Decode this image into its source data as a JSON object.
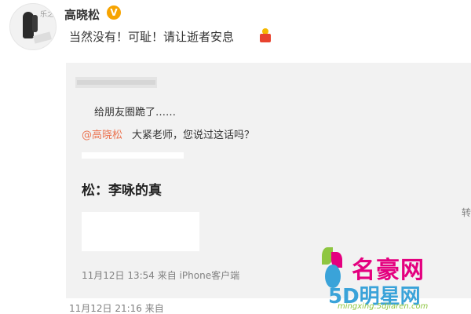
{
  "post": {
    "username": "高晓松",
    "badge": "V",
    "text": "当然没有！可耻！请让逝者安息",
    "emoji_icon": "candle-icon"
  },
  "repost": {
    "text1": "给朋友圈跪了……",
    "mention": "@高晓松",
    "text2": "大紧老师，您说过这话吗？",
    "image_text": "松：李咏的真",
    "meta": "11月12日 13:54 来自 iPhone客户端",
    "right_fragment": "转"
  },
  "outer_meta": "11月12日 21:16 来自",
  "watermark": {
    "brand": "名豪网",
    "brand2": "5D明星网",
    "url": "mingxing.5djiaren.com"
  },
  "colors": {
    "mention": "#eb7350",
    "vbadge": "#f7a400",
    "repost_bg": "#f2f2f2"
  }
}
